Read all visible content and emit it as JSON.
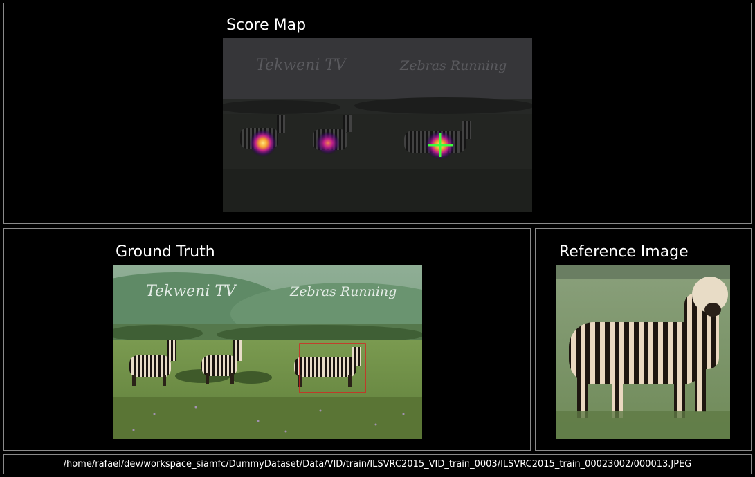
{
  "panels": {
    "score_map": {
      "title": "Score Map",
      "watermark_left": "Tekweni TV",
      "watermark_right": "Zebras Running"
    },
    "ground_truth": {
      "title": "Ground Truth",
      "watermark_left": "Tekweni TV",
      "watermark_right": "Zebras Running"
    },
    "reference": {
      "title": "Reference Image"
    }
  },
  "status_bar": {
    "path": "/home/rafael/dev/workspace_siamfc/DummyDataset/Data/VID/train/ILSVRC2015_VID_train_0003/ILSVRC2015_train_00023002/000013.JPEG"
  },
  "colors": {
    "background": "#000000",
    "border": "#8a8a8a",
    "crosshair": "#3cff3c",
    "bbox": "#d82020",
    "heat_hot": "#ffd040",
    "heat_mid": "#c0208a",
    "heat_low": "#4a0a70"
  },
  "icons": {
    "peak_marker": "crosshair-icon"
  }
}
